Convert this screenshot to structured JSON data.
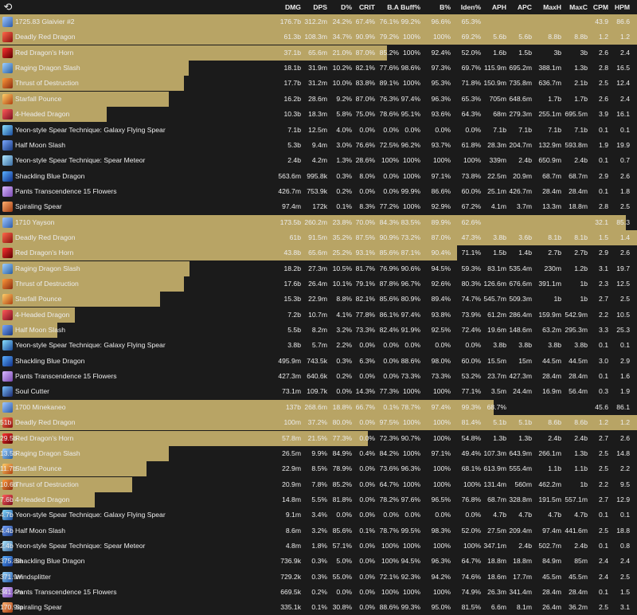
{
  "columns": [
    "DMG",
    "DPS",
    "D%",
    "CRIT",
    "B.A",
    "Buff%",
    "B%",
    "Iden%",
    "APH",
    "APC",
    "MaxH",
    "MaxC",
    "CPM",
    "HPM"
  ],
  "header_icon": "meter-icon",
  "colors": {
    "bar": "#b8a465",
    "background": "#1b1b1b"
  },
  "groups": [
    {
      "name": "1725.83 Glaivier #2",
      "icon": "glaive-icon",
      "bar_fraction": 1.0,
      "values": [
        "176.7b",
        "312.2m",
        "24.2%",
        "67.4%",
        "76.1%",
        "99.2%",
        "96.6%",
        "65.3%",
        "",
        "",
        "",
        "",
        "43.9",
        "86.6"
      ],
      "skills": [
        {
          "name": "Deadly Red Dragon",
          "icon": "red-dragon-icon",
          "bar_fraction": 1.0,
          "values": [
            "61.3b",
            "108.3m",
            "34.7%",
            "90.9%",
            "79.2%",
            "100%",
            "100%",
            "69.2%",
            "5.6b",
            "5.6b",
            "8.8b",
            "8.8b",
            "1.2",
            "1.2"
          ]
        },
        {
          "name": "Red Dragon's Horn",
          "icon": "dragon-horn-icon",
          "bar_fraction": 0.607,
          "values": [
            "37.1b",
            "65.6m",
            "21.0%",
            "87.0%",
            "85.2%",
            "100%",
            "92.4%",
            "52.0%",
            "1.6b",
            "1.5b",
            "3b",
            "3b",
            "2.6",
            "2.4"
          ]
        },
        {
          "name": "Raging Dragon Slash",
          "icon": "dragon-slash-icon",
          "bar_fraction": 0.296,
          "values": [
            "18.1b",
            "31.9m",
            "10.2%",
            "82.1%",
            "77.6%",
            "98.6%",
            "97.3%",
            "69.7%",
            "115.9m",
            "695.2m",
            "388.1m",
            "1.3b",
            "2.8",
            "16.5"
          ]
        },
        {
          "name": "Thrust of Destruction",
          "icon": "thrust-icon",
          "bar_fraction": 0.289,
          "values": [
            "17.7b",
            "31.2m",
            "10.0%",
            "83.8%",
            "89.1%",
            "100%",
            "95.3%",
            "71.8%",
            "150.9m",
            "735.8m",
            "636.7m",
            "2.1b",
            "2.5",
            "12.4"
          ]
        },
        {
          "name": "Starfall Pounce",
          "icon": "starfall-icon",
          "bar_fraction": 0.265,
          "values": [
            "16.2b",
            "28.6m",
            "9.2%",
            "87.0%",
            "76.3%",
            "97.4%",
            "96.3%",
            "65.3%",
            "705m",
            "648.6m",
            "1.7b",
            "1.7b",
            "2.6",
            "2.4"
          ]
        },
        {
          "name": "4-Headed Dragon",
          "icon": "four-headed-dragon-icon",
          "bar_fraction": 0.168,
          "values": [
            "10.3b",
            "18.3m",
            "5.8%",
            "75.0%",
            "78.6%",
            "95.1%",
            "93.6%",
            "64.3%",
            "68m",
            "279.3m",
            "255.1m",
            "695.5m",
            "3.9",
            "16.1"
          ]
        },
        {
          "name": "Yeon-style Spear Technique: Galaxy Flying Spear",
          "icon": "galaxy-spear-icon",
          "bar_fraction": 0.0,
          "values": [
            "7.1b",
            "12.5m",
            "4.0%",
            "0.0%",
            "0.0%",
            "0.0%",
            "0.0%",
            "0.0%",
            "7.1b",
            "7.1b",
            "7.1b",
            "7.1b",
            "0.1",
            "0.1"
          ]
        },
        {
          "name": "Half Moon Slash",
          "icon": "half-moon-icon",
          "bar_fraction": 0.0,
          "values": [
            "5.3b",
            "9.4m",
            "3.0%",
            "76.6%",
            "72.5%",
            "96.2%",
            "93.7%",
            "61.8%",
            "28.3m",
            "204.7m",
            "132.9m",
            "593.8m",
            "1.9",
            "19.9"
          ]
        },
        {
          "name": "Yeon-style Spear Technique: Spear Meteor",
          "icon": "spear-meteor-icon",
          "bar_fraction": 0.0,
          "values": [
            "2.4b",
            "4.2m",
            "1.3%",
            "28.6%",
            "100%",
            "100%",
            "100%",
            "100%",
            "339m",
            "2.4b",
            "650.9m",
            "2.4b",
            "0.1",
            "0.7"
          ]
        },
        {
          "name": "Shackling Blue Dragon",
          "icon": "blue-dragon-icon",
          "bar_fraction": 0.0,
          "values": [
            "563.6m",
            "995.8k",
            "0.3%",
            "8.0%",
            "0.0%",
            "100%",
            "97.1%",
            "73.8%",
            "22.5m",
            "20.9m",
            "68.7m",
            "68.7m",
            "2.9",
            "2.6"
          ]
        },
        {
          "name": "Pants Transcendence 15 Flowers",
          "icon": "pants-icon",
          "bar_fraction": 0.0,
          "values": [
            "426.7m",
            "753.9k",
            "0.2%",
            "0.0%",
            "0.0%",
            "99.9%",
            "86.6%",
            "60.0%",
            "25.1m",
            "426.7m",
            "28.4m",
            "28.4m",
            "0.1",
            "1.8"
          ]
        },
        {
          "name": "Spiraling Spear",
          "icon": "spiraling-spear-icon",
          "bar_fraction": 0.0,
          "values": [
            "97.4m",
            "172k",
            "0.1%",
            "8.3%",
            "77.2%",
            "100%",
            "92.9%",
            "67.2%",
            "4.1m",
            "3.7m",
            "13.3m",
            "18.8m",
            "2.8",
            "2.5"
          ]
        }
      ]
    },
    {
      "name": "1710 Yayson",
      "icon": "glaive-icon",
      "bar_fraction": 0.982,
      "values": [
        "173.5b",
        "260.2m",
        "23.8%",
        "70.0%",
        "84.3%",
        "83.5%",
        "89.9%",
        "62.6%",
        "",
        "",
        "",
        "",
        "32.1",
        "85.3"
      ],
      "skills": [
        {
          "name": "Deadly Red Dragon",
          "icon": "red-dragon-icon",
          "bar_fraction": 1.0,
          "values": [
            "61b",
            "91.5m",
            "35.2%",
            "87.5%",
            "90.9%",
            "73.2%",
            "87.0%",
            "47.3%",
            "3.8b",
            "3.6b",
            "8.1b",
            "8.1b",
            "1.5",
            "1.4"
          ]
        },
        {
          "name": "Red Dragon's Horn",
          "icon": "dragon-horn-icon",
          "bar_fraction": 0.718,
          "values": [
            "43.8b",
            "65.6m",
            "25.2%",
            "93.1%",
            "85.6%",
            "87.1%",
            "90.4%",
            "71.1%",
            "1.5b",
            "1.4b",
            "2.7b",
            "2.7b",
            "2.9",
            "2.6"
          ]
        },
        {
          "name": "Raging Dragon Slash",
          "icon": "dragon-slash-icon",
          "bar_fraction": 0.298,
          "values": [
            "18.2b",
            "27.3m",
            "10.5%",
            "81.7%",
            "76.9%",
            "90.6%",
            "94.5%",
            "59.3%",
            "83.1m",
            "535.4m",
            "230m",
            "1.2b",
            "3.1",
            "19.7"
          ]
        },
        {
          "name": "Thrust of Destruction",
          "icon": "thrust-icon",
          "bar_fraction": 0.289,
          "values": [
            "17.6b",
            "26.4m",
            "10.1%",
            "79.1%",
            "87.8%",
            "96.7%",
            "92.6%",
            "80.3%",
            "126.6m",
            "676.6m",
            "391.1m",
            "1b",
            "2.3",
            "12.5"
          ]
        },
        {
          "name": "Starfall Pounce",
          "icon": "starfall-icon",
          "bar_fraction": 0.251,
          "values": [
            "15.3b",
            "22.9m",
            "8.8%",
            "82.1%",
            "85.6%",
            "80.9%",
            "89.4%",
            "74.7%",
            "545.7m",
            "509.3m",
            "1b",
            "1b",
            "2.7",
            "2.5"
          ]
        },
        {
          "name": "4-Headed Dragon",
          "icon": "four-headed-dragon-icon",
          "bar_fraction": 0.118,
          "values": [
            "7.2b",
            "10.7m",
            "4.1%",
            "77.8%",
            "86.1%",
            "97.4%",
            "93.8%",
            "73.9%",
            "61.2m",
            "286.4m",
            "159.9m",
            "542.9m",
            "2.2",
            "10.5"
          ]
        },
        {
          "name": "Half Moon Slash",
          "icon": "half-moon-icon",
          "bar_fraction": 0.09,
          "values": [
            "5.5b",
            "8.2m",
            "3.2%",
            "73.3%",
            "82.4%",
            "91.9%",
            "92.5%",
            "72.4%",
            "19.6m",
            "148.6m",
            "63.2m",
            "295.3m",
            "3.3",
            "25.3"
          ]
        },
        {
          "name": "Yeon-style Spear Technique: Galaxy Flying Spear",
          "icon": "galaxy-spear-icon",
          "bar_fraction": 0.0,
          "values": [
            "3.8b",
            "5.7m",
            "2.2%",
            "0.0%",
            "0.0%",
            "0.0%",
            "0.0%",
            "0.0%",
            "3.8b",
            "3.8b",
            "3.8b",
            "3.8b",
            "0.1",
            "0.1"
          ]
        },
        {
          "name": "Shackling Blue Dragon",
          "icon": "blue-dragon-icon",
          "bar_fraction": 0.0,
          "values": [
            "495.9m",
            "743.5k",
            "0.3%",
            "6.3%",
            "0.0%",
            "88.6%",
            "98.0%",
            "60.0%",
            "15.5m",
            "15m",
            "44.5m",
            "44.5m",
            "3.0",
            "2.9"
          ]
        },
        {
          "name": "Pants Transcendence 15 Flowers",
          "icon": "pants-icon",
          "bar_fraction": 0.0,
          "values": [
            "427.3m",
            "640.6k",
            "0.2%",
            "0.0%",
            "0.0%",
            "73.3%",
            "73.3%",
            "53.2%",
            "23.7m",
            "427.3m",
            "28.4m",
            "28.4m",
            "0.1",
            "1.6"
          ]
        },
        {
          "name": "Soul Cutter",
          "icon": "soul-cutter-icon",
          "bar_fraction": 0.0,
          "values": [
            "73.1m",
            "109.7k",
            "0.0%",
            "14.3%",
            "77.3%",
            "100%",
            "100%",
            "77.1%",
            "3.5m",
            "24.4m",
            "16.9m",
            "56.4m",
            "0.3",
            "1.9"
          ]
        }
      ]
    },
    {
      "name": "1700 Minekaneo",
      "icon": "glaive-icon",
      "bar_fraction": 0.775,
      "values": [
        "137b",
        "268.6m",
        "18.8%",
        "66.7%",
        "0.1%",
        "78.7%",
        "97.4%",
        "99.3%",
        "68.7%",
        "",
        "",
        "",
        "45.6",
        "86.1"
      ],
      "skills": [
        {
          "name": "Deadly Red Dragon",
          "icon": "red-dragon-icon",
          "bar_fraction": 1.0,
          "values": [
            "51b",
            "100m",
            "37.2%",
            "80.0%",
            "0.0%",
            "97.5%",
            "100%",
            "100%",
            "81.4%",
            "5.1b",
            "5.1b",
            "8.6b",
            "8.6b",
            "1.2",
            "1.2"
          ]
        },
        {
          "name": "Red Dragon's Horn",
          "icon": "dragon-horn-icon",
          "bar_fraction": 0.577,
          "values": [
            "29.5b",
            "57.8m",
            "21.5%",
            "77.3%",
            "0.0%",
            "72.3%",
            "90.7%",
            "100%",
            "54.8%",
            "1.3b",
            "1.3b",
            "2.4b",
            "2.4b",
            "2.7",
            "2.6"
          ]
        },
        {
          "name": "Raging Dragon Slash",
          "icon": "dragon-slash-icon",
          "bar_fraction": 0.265,
          "values": [
            "13.5b",
            "26.5m",
            "9.9%",
            "84.9%",
            "0.4%",
            "84.2%",
            "100%",
            "97.1%",
            "49.4%",
            "107.3m",
            "643.9m",
            "266.1m",
            "1.3b",
            "2.5",
            "14.8"
          ]
        },
        {
          "name": "Starfall Pounce",
          "icon": "starfall-icon",
          "bar_fraction": 0.23,
          "values": [
            "11.7b",
            "22.9m",
            "8.5%",
            "78.9%",
            "0.0%",
            "73.6%",
            "96.3%",
            "100%",
            "68.1%",
            "613.9m",
            "555.4m",
            "1.1b",
            "1.1b",
            "2.5",
            "2.2"
          ]
        },
        {
          "name": "Thrust of Destruction",
          "icon": "thrust-icon",
          "bar_fraction": 0.208,
          "values": [
            "10.6b",
            "20.9m",
            "7.8%",
            "85.2%",
            "0.0%",
            "64.7%",
            "100%",
            "100%",
            "100%",
            "131.4m",
            "560m",
            "462.2m",
            "1b",
            "2.2",
            "9.5"
          ]
        },
        {
          "name": "4-Headed Dragon",
          "icon": "four-headed-dragon-icon",
          "bar_fraction": 0.149,
          "values": [
            "7.6b",
            "14.8m",
            "5.5%",
            "81.8%",
            "0.0%",
            "78.2%",
            "97.6%",
            "96.5%",
            "76.8%",
            "68.7m",
            "328.8m",
            "191.5m",
            "557.1m",
            "2.7",
            "12.9"
          ]
        },
        {
          "name": "Yeon-style Spear Technique: Galaxy Flying Spear",
          "icon": "galaxy-spear-icon",
          "bar_fraction": 0.0,
          "values": [
            "4.7b",
            "9.1m",
            "3.4%",
            "0.0%",
            "0.0%",
            "0.0%",
            "0.0%",
            "0.0%",
            "0.0%",
            "4.7b",
            "4.7b",
            "4.7b",
            "4.7b",
            "0.1",
            "0.1"
          ]
        },
        {
          "name": "Half Moon Slash",
          "icon": "half-moon-icon",
          "bar_fraction": 0.0,
          "values": [
            "4.4b",
            "8.6m",
            "3.2%",
            "85.6%",
            "0.1%",
            "78.7%",
            "99.5%",
            "98.3%",
            "52.0%",
            "27.5m",
            "209.4m",
            "97.4m",
            "441.6m",
            "2.5",
            "18.8"
          ]
        },
        {
          "name": "Yeon-style Spear Technique: Spear Meteor",
          "icon": "spear-meteor-icon",
          "bar_fraction": 0.0,
          "values": [
            "2.4b",
            "4.8m",
            "1.8%",
            "57.1%",
            "0.0%",
            "100%",
            "100%",
            "100%",
            "100%",
            "347.1m",
            "2.4b",
            "502.7m",
            "2.4b",
            "0.1",
            "0.8"
          ]
        },
        {
          "name": "Shackling Blue Dragon",
          "icon": "blue-dragon-icon",
          "bar_fraction": 0.0,
          "values": [
            "375.8m",
            "736.9k",
            "0.3%",
            "5.0%",
            "0.0%",
            "100%",
            "94.5%",
            "96.3%",
            "64.7%",
            "18.8m",
            "18.8m",
            "84.9m",
            "85m",
            "2.4",
            "2.4"
          ]
        },
        {
          "name": "Windsplitter",
          "icon": "windsplitter-icon",
          "bar_fraction": 0.0,
          "values": [
            "371.9m",
            "729.2k",
            "0.3%",
            "55.0%",
            "0.0%",
            "72.1%",
            "92.3%",
            "94.2%",
            "74.6%",
            "18.6m",
            "17.7m",
            "45.5m",
            "45.5m",
            "2.4",
            "2.5"
          ]
        },
        {
          "name": "Pants Transcendence 15 Flowers",
          "icon": "pants-icon",
          "bar_fraction": 0.0,
          "values": [
            "341.4m",
            "669.5k",
            "0.2%",
            "0.0%",
            "0.0%",
            "100%",
            "100%",
            "100%",
            "74.9%",
            "26.3m",
            "341.4m",
            "28.4m",
            "28.4m",
            "0.1",
            "1.5"
          ]
        },
        {
          "name": "Spiraling Spear",
          "icon": "spiraling-spear-icon",
          "bar_fraction": 0.0,
          "values": [
            "170.9m",
            "335.1k",
            "0.1%",
            "30.8%",
            "0.0%",
            "88.6%",
            "99.3%",
            "95.0%",
            "81.5%",
            "6.6m",
            "8.1m",
            "26.4m",
            "36.2m",
            "2.5",
            "3.1"
          ]
        }
      ]
    }
  ]
}
